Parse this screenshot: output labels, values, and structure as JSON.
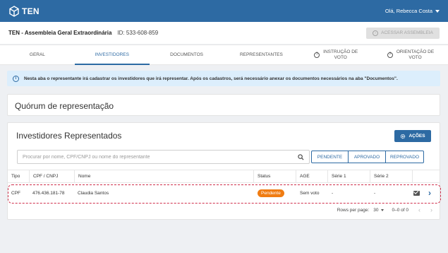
{
  "app": {
    "brand": "TEN",
    "greeting": "Olá, Rebecca Costa"
  },
  "header": {
    "title": "TEN - Assembleia Geral Extraordinária",
    "id_label": "ID: 533-608-859",
    "access_button": "ACESSAR ASSEMBLEIA"
  },
  "tabs": [
    {
      "label": "GERAL"
    },
    {
      "label": "INVESTIDORES"
    },
    {
      "label": "DOCUMENTOS"
    },
    {
      "label": "REPRESENTANTES"
    },
    {
      "label_line1": "INSTRUÇÃO DE",
      "label_line2": "VOTO"
    },
    {
      "label_line1": "ORIENTAÇÃO DE",
      "label_line2": "VOTO"
    }
  ],
  "info": {
    "text": "Nesta aba o representante irá cadastrar os investidores que irá representar. Após os cadastros, será necessário anexar os documentos necessários na aba \"Documentos\"."
  },
  "quorum": {
    "title": "Quórum de representação"
  },
  "investors": {
    "title": "Investidores Representados",
    "actions_button": "AÇÕES",
    "search_placeholder": "Procurar por nome, CPF/CNPJ ou nome do representante",
    "filters": [
      "PENDENTE",
      "APROVADO",
      "REPROVADO"
    ],
    "columns": [
      "Tipo",
      "CPF / CNPJ",
      "Nome",
      "Status",
      "AGE",
      "Série 1",
      "Série 2"
    ],
    "rows": [
      {
        "tipo": "CPF",
        "doc": "476.436.181-78",
        "nome": "Claudia Santos",
        "status": "Pendente",
        "age": "Sem voto",
        "serie1": "-",
        "serie2": "-"
      }
    ],
    "pagination": {
      "rows_per_page_label": "Rows per page:",
      "rows_per_page": "30",
      "range": "0–0 of 0"
    }
  },
  "colors": {
    "primary": "#2d6aa3",
    "pending": "#f07c12",
    "highlight": "#d0304c"
  }
}
